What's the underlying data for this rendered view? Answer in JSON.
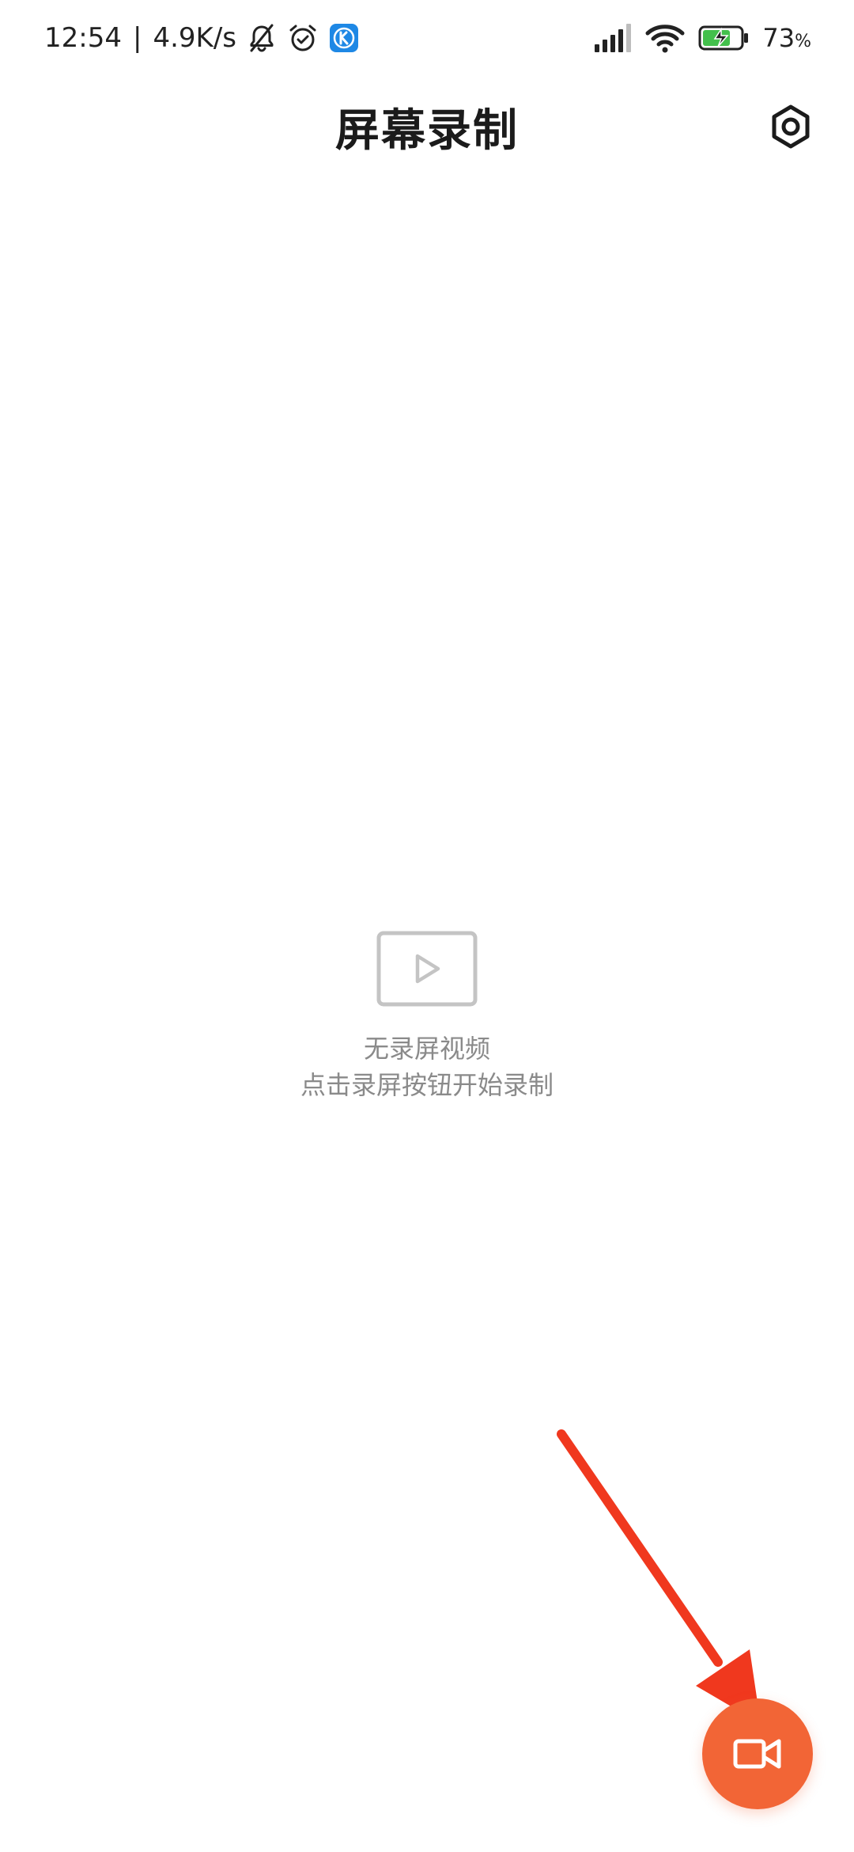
{
  "status_bar": {
    "time": "12:54",
    "separator": "|",
    "network_speed": "4.9K/s",
    "battery_percent": "73",
    "battery_unit": "%",
    "icons": [
      "bell-off-icon",
      "alarm-icon",
      "k-app-icon",
      "signal-icon",
      "wifi-icon",
      "battery-charging-icon"
    ]
  },
  "header": {
    "title": "屏幕录制",
    "settings_icon": "settings-hex-icon"
  },
  "empty_state": {
    "icon": "video-placeholder-icon",
    "line1": "无录屏视频",
    "line2": "点击录屏按钮开始录制"
  },
  "fab": {
    "icon": "video-camera-icon",
    "color": "#f26536"
  },
  "annotation": {
    "arrow_color": "#f0381e"
  }
}
